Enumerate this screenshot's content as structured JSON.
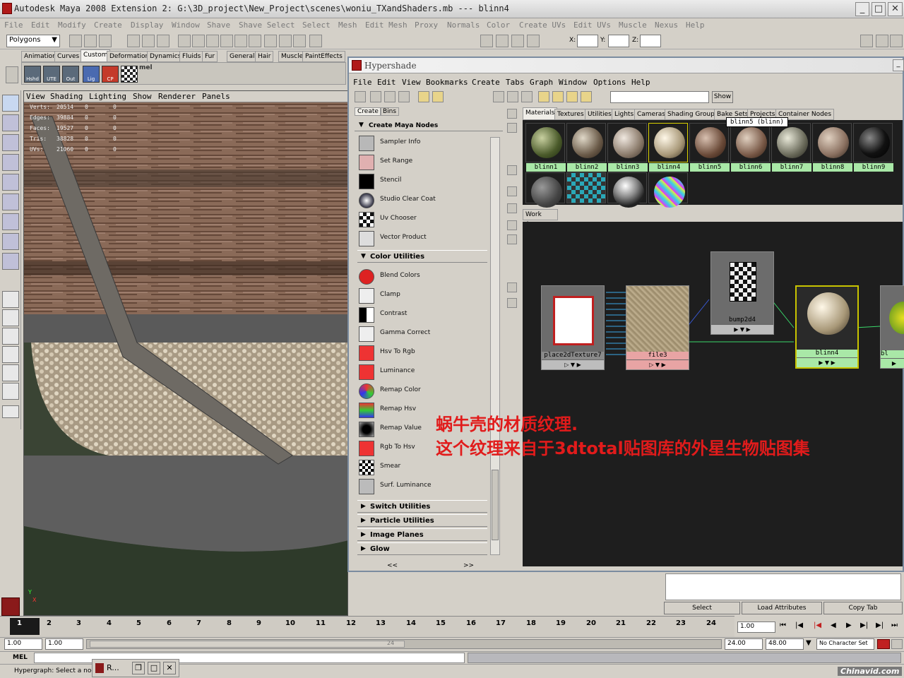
{
  "window": {
    "title": "Autodesk Maya 2008 Extension 2: G:\\3D_project\\New_Project\\scenes\\woniu_TXandShaders.mb    ---    blinn4",
    "menu": [
      "File",
      "Edit",
      "Modify",
      "Create",
      "Display",
      "Window",
      "Shave",
      "Shave Select",
      "Select",
      "Mesh",
      "Edit Mesh",
      "Proxy",
      "Normals",
      "Color",
      "Create UVs",
      "Edit UVs",
      "Muscle",
      "Nexus",
      "Help"
    ]
  },
  "statusline": {
    "mode": "Polygons",
    "x_label": "X:",
    "y_label": "Y:",
    "z_label": "Z:"
  },
  "shelf": {
    "tabs": [
      "Animation",
      "Curves",
      "Custom",
      "Deformation",
      "Dynamics",
      "Fluids",
      "Fur",
      "General",
      "Hair",
      "Muscle",
      "PaintEffects"
    ],
    "active_tab": "Custom",
    "buttons": [
      "Hshd",
      "UTE",
      "Out",
      "Lig",
      "CP"
    ],
    "mel_label": "mel"
  },
  "viewport": {
    "menu": [
      "View",
      "Shading",
      "Lighting",
      "Show",
      "Renderer",
      "Panels"
    ],
    "hud": [
      {
        "label": "Verts:",
        "v1": "20514",
        "v2": "0",
        "v3": "0"
      },
      {
        "label": "Edges:",
        "v1": "39884",
        "v2": "0",
        "v3": "0"
      },
      {
        "label": "Faces:",
        "v1": "19527",
        "v2": "0",
        "v3": "0"
      },
      {
        "label": "Tris:",
        "v1": "38828",
        "v2": "0",
        "v3": "0"
      },
      {
        "label": "UVs:",
        "v1": "21060",
        "v2": "0",
        "v3": "0"
      }
    ],
    "axis_y": "Y",
    "axis_x": "X"
  },
  "hypershade": {
    "title": "Hypershade",
    "menu": [
      "File",
      "Edit",
      "View",
      "Bookmarks",
      "Create",
      "Tabs",
      "Graph",
      "Window",
      "Options",
      "Help"
    ],
    "show_button": "Show",
    "create_tabs": [
      "Create",
      "Bins"
    ],
    "create_header": "Create Maya Nodes",
    "nodes_top": [
      "Sampler Info",
      "Set Range",
      "Stencil",
      "Studio Clear Coat",
      "Uv Chooser",
      "Vector Product"
    ],
    "color_utilities_header": "Color Utilities",
    "color_nodes": [
      "Blend Colors",
      "Clamp",
      "Contrast",
      "Gamma Correct",
      "Hsv To Rgb",
      "Luminance",
      "Remap Color",
      "Remap Hsv",
      "Remap Value",
      "Rgb To Hsv",
      "Smear",
      "Surf. Luminance"
    ],
    "collapsed_sections": [
      "Switch Utilities",
      "Particle Utilities",
      "Image Planes",
      "Glow"
    ],
    "nav_prev": "<<",
    "nav_next": ">>",
    "material_tabs": [
      "Materials",
      "Textures",
      "Utilities",
      "Lights",
      "Cameras",
      "Shading Groups",
      "Bake Sets",
      "Projects",
      "Container Nodes"
    ],
    "materials": [
      "blinn1",
      "blinn2",
      "blinn3",
      "blinn4",
      "blinn5",
      "blinn6",
      "blinn7",
      "blinn8",
      "blinn9"
    ],
    "tooltip": "blinn5 (blinn)",
    "work_area_tab": "Work Area",
    "graph_nodes": {
      "place2d": "place2dTexture7",
      "file": "file3",
      "bump": "bump2d4",
      "blinn": "blinn4",
      "partial": "bl"
    }
  },
  "annotation": {
    "line1": "蜗牛壳的材质纹理.",
    "line2": "这个纹理来自于3dtotal贴图库的外星生物贴图集"
  },
  "bottom_buttons": [
    "Select",
    "Load Attributes",
    "Copy Tab"
  ],
  "timeline": {
    "ticks": [
      "1",
      "2",
      "3",
      "4",
      "5",
      "6",
      "7",
      "8",
      "9",
      "10",
      "11",
      "12",
      "13",
      "14",
      "15",
      "16",
      "17",
      "18",
      "19",
      "20",
      "21",
      "22",
      "23",
      "24"
    ],
    "current": "1.00"
  },
  "range": {
    "start": "1.00",
    "playback_start": "1.00",
    "slider_end_label": "24",
    "playback_end": "24.00",
    "end": "48.00",
    "character_set": "No Character Set"
  },
  "mel": {
    "label": "MEL"
  },
  "help": {
    "text": "Hypergraph: Select a node."
  },
  "taskbar": {
    "item": "R..."
  },
  "watermark": "Chinavid.com",
  "colors": {
    "annotation": "#e11b1b",
    "material_label": "#a9e8a7",
    "file_node": "#e8a4a4",
    "selected_node": "#c8c400"
  }
}
